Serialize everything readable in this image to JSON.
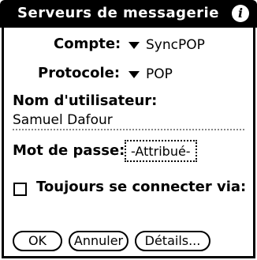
{
  "dialog": {
    "title": "Serveurs de messagerie",
    "info_icon": "info-icon"
  },
  "account": {
    "label": "Compte:",
    "value": "SyncPOP"
  },
  "protocol": {
    "label": "Protocole:",
    "value": "POP"
  },
  "username": {
    "label": "Nom d'utilisateur:",
    "value": "Samuel Dafour"
  },
  "password": {
    "label": "Mot de passe:",
    "value": "-Attribué-"
  },
  "always_connect": {
    "label": "Toujours se connecter via:",
    "checked": false
  },
  "buttons": {
    "ok": "OK",
    "cancel": "Annuler",
    "details": "Détails..."
  }
}
